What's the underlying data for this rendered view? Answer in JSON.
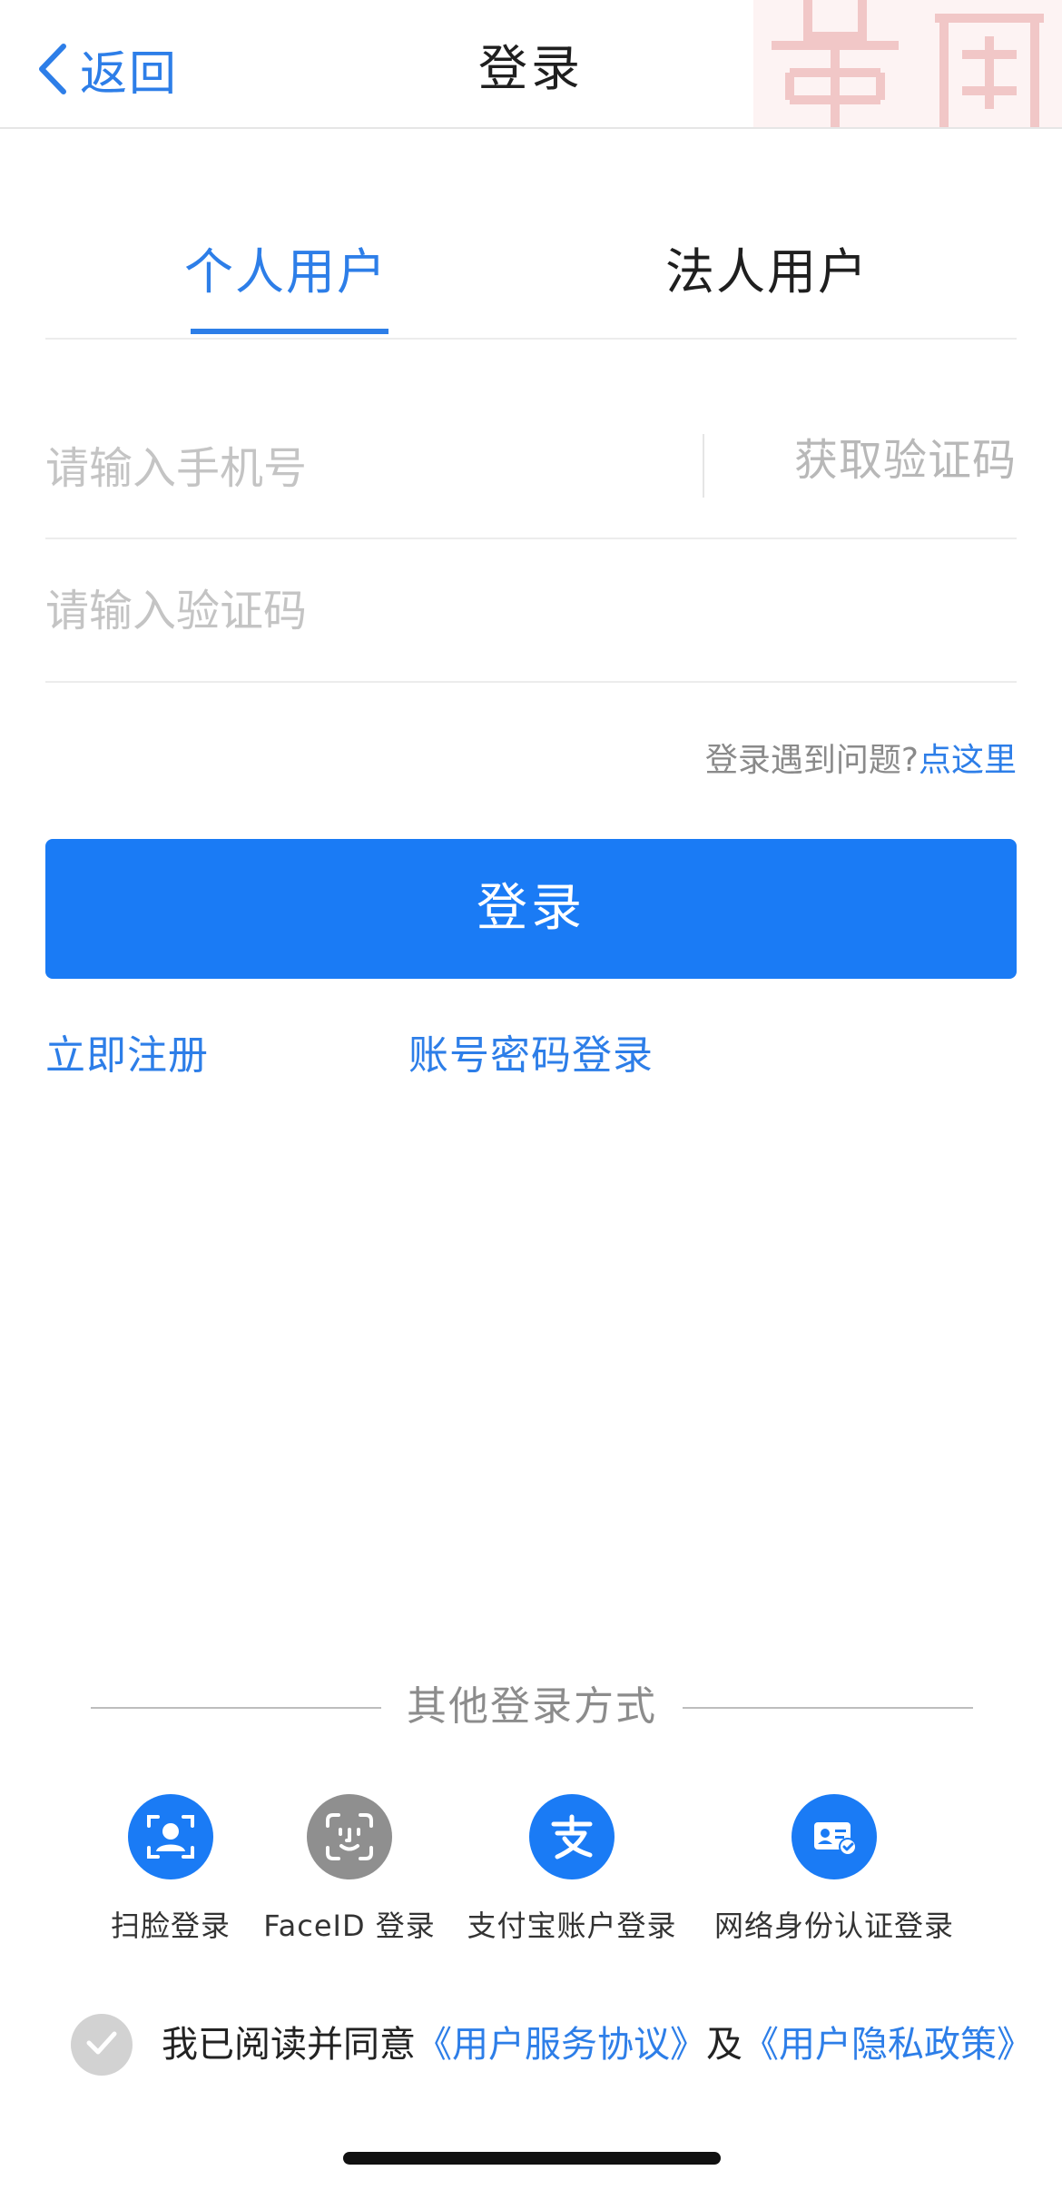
{
  "nav": {
    "back_label": "返回",
    "title": "登录"
  },
  "tabs": [
    {
      "label": "个人用户",
      "active": true
    },
    {
      "label": "法人用户",
      "active": false
    }
  ],
  "form": {
    "phone_placeholder": "请输入手机号",
    "get_code_label": "获取验证码",
    "code_placeholder": "请输入验证码",
    "help_text": "登录遇到问题?",
    "help_link": "点这里",
    "login_button": "登录",
    "register_link": "立即注册",
    "password_login_link": "账号密码登录"
  },
  "other_methods": {
    "title": "其他登录方式",
    "items": [
      {
        "label": "扫脸登录",
        "icon": "face-scan-icon",
        "color": "#1a7bf5"
      },
      {
        "label": "FaceID 登录",
        "icon": "faceid-icon",
        "color": "#8f8f8f"
      },
      {
        "label": "支付宝账户登录",
        "icon": "alipay-icon",
        "color": "#1a7bf5"
      },
      {
        "label": "网络身份认证登录",
        "icon": "id-card-icon",
        "color": "#1a7bf5"
      }
    ]
  },
  "agreement": {
    "prefix": "我已阅读并同意",
    "service_link": "《用户服务协议》",
    "conjunction": "及",
    "privacy_link": "《用户隐私政策》"
  },
  "colors": {
    "accent": "#2d7ee8",
    "button": "#1a7bf5",
    "placeholder": "#c4c4c4",
    "divider": "#ececec"
  }
}
